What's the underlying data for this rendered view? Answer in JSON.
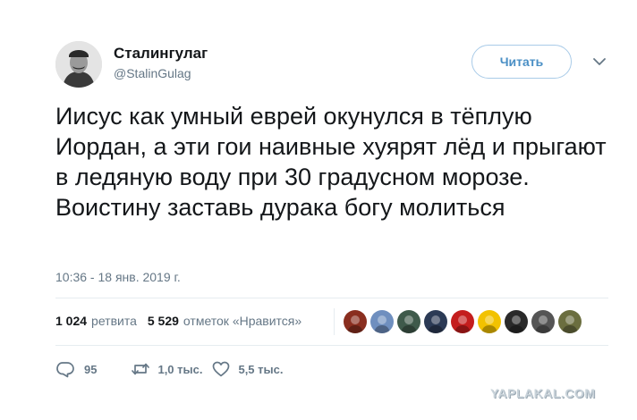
{
  "author": {
    "name": "Сталингулаг",
    "handle": "@StalinGulag"
  },
  "follow_button": {
    "label": "Читать"
  },
  "menu_icon": "chevron-down-icon",
  "tweet": {
    "text": "Иисус как умный еврей окунулся в тёплую Иордан, а эти гои наивные хуярят лёд и прыгают в ледяную воду при 30 градусном морозе. Воистину заставь дурака богу молиться",
    "timestamp": "10:36 - 18 янв. 2019 г."
  },
  "stats": {
    "retweets_count": "1 024",
    "retweets_label": "ретвита",
    "likes_count": "5 529",
    "likes_label": "отметок «Нравится»"
  },
  "likers": [
    {
      "icon": "avatar",
      "color": "#8a2e1f"
    },
    {
      "icon": "avatar",
      "color": "#6f8fbf"
    },
    {
      "icon": "avatar",
      "color": "#3f5a4b"
    },
    {
      "icon": "avatar",
      "color": "#2b3a55"
    },
    {
      "icon": "avatar",
      "color": "#c41e1e"
    },
    {
      "icon": "avatar",
      "color": "#f2c200"
    },
    {
      "icon": "avatar",
      "color": "#2a2a2a"
    },
    {
      "icon": "avatar",
      "color": "#555555"
    },
    {
      "icon": "avatar",
      "color": "#6b6e3f"
    }
  ],
  "actions": {
    "replies": "95",
    "retweets": "1,0 тыс.",
    "likes": "5,5 тыс."
  },
  "watermark": "YAPLAKAL.COM",
  "colors": {
    "text": "#14171a",
    "secondary": "#657786",
    "accent": "#4a8fc5",
    "divider": "#e6ecf0"
  }
}
